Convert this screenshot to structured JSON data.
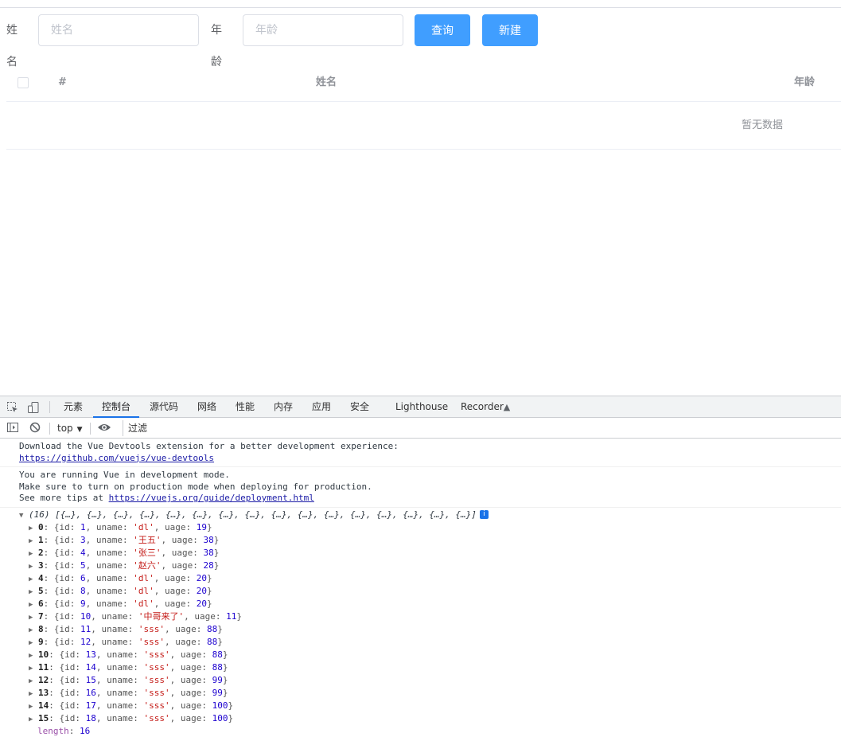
{
  "form": {
    "name_label": "姓名",
    "name_placeholder": "姓名",
    "age_label": "年龄",
    "age_placeholder": "年龄",
    "query_button": "查询",
    "new_button": "新建"
  },
  "table": {
    "headers": [
      "#",
      "姓名",
      "年龄"
    ],
    "empty_text": "暂无数据"
  },
  "devtools": {
    "tabs": [
      "元素",
      "控制台",
      "源代码",
      "网络",
      "性能",
      "内存",
      "应用",
      "安全",
      "Lighthouse",
      "Recorder"
    ],
    "active_tab": "控制台",
    "context": "top",
    "filter_placeholder": "过滤",
    "messages": [
      {
        "lines": [
          "Download the Vue Devtools extension for a better development experience:"
        ],
        "link": "https://github.com/vuejs/vue-devtools"
      },
      {
        "lines": [
          "You are running Vue in development mode.",
          "Make sure to turn on production mode when deploying for production."
        ],
        "link_prefix": "See more tips at ",
        "link": "https://vuejs.org/guide/deployment.html"
      }
    ],
    "array_summary": "(16) [{…}, {…}, {…}, {…}, {…}, {…}, {…}, {…}, {…}, {…}, {…}, {…}, {…}, {…}, {…}, {…}]",
    "rows": [
      {
        "index": "0",
        "id": "1",
        "uname": "dl",
        "uage": "19"
      },
      {
        "index": "1",
        "id": "3",
        "uname": "王五",
        "uage": "38"
      },
      {
        "index": "2",
        "id": "4",
        "uname": "张三",
        "uage": "38"
      },
      {
        "index": "3",
        "id": "5",
        "uname": "赵六",
        "uage": "28"
      },
      {
        "index": "4",
        "id": "6",
        "uname": "dl",
        "uage": "20"
      },
      {
        "index": "5",
        "id": "8",
        "uname": "dl",
        "uage": "20"
      },
      {
        "index": "6",
        "id": "9",
        "uname": "dl",
        "uage": "20"
      },
      {
        "index": "7",
        "id": "10",
        "uname": "中哥来了",
        "uage": "11"
      },
      {
        "index": "8",
        "id": "11",
        "uname": "sss",
        "uage": "88"
      },
      {
        "index": "9",
        "id": "12",
        "uname": "sss",
        "uage": "88"
      },
      {
        "index": "10",
        "id": "13",
        "uname": "sss",
        "uage": "88"
      },
      {
        "index": "11",
        "id": "14",
        "uname": "sss",
        "uage": "88"
      },
      {
        "index": "12",
        "id": "15",
        "uname": "sss",
        "uage": "99"
      },
      {
        "index": "13",
        "id": "16",
        "uname": "sss",
        "uage": "99"
      },
      {
        "index": "14",
        "id": "17",
        "uname": "sss",
        "uage": "100"
      },
      {
        "index": "15",
        "id": "18",
        "uname": "sss",
        "uage": "100"
      }
    ],
    "length_label": "length",
    "length_value": "16"
  },
  "colors": {
    "primary": "#409eff",
    "active_tab": "#1a73e8"
  }
}
